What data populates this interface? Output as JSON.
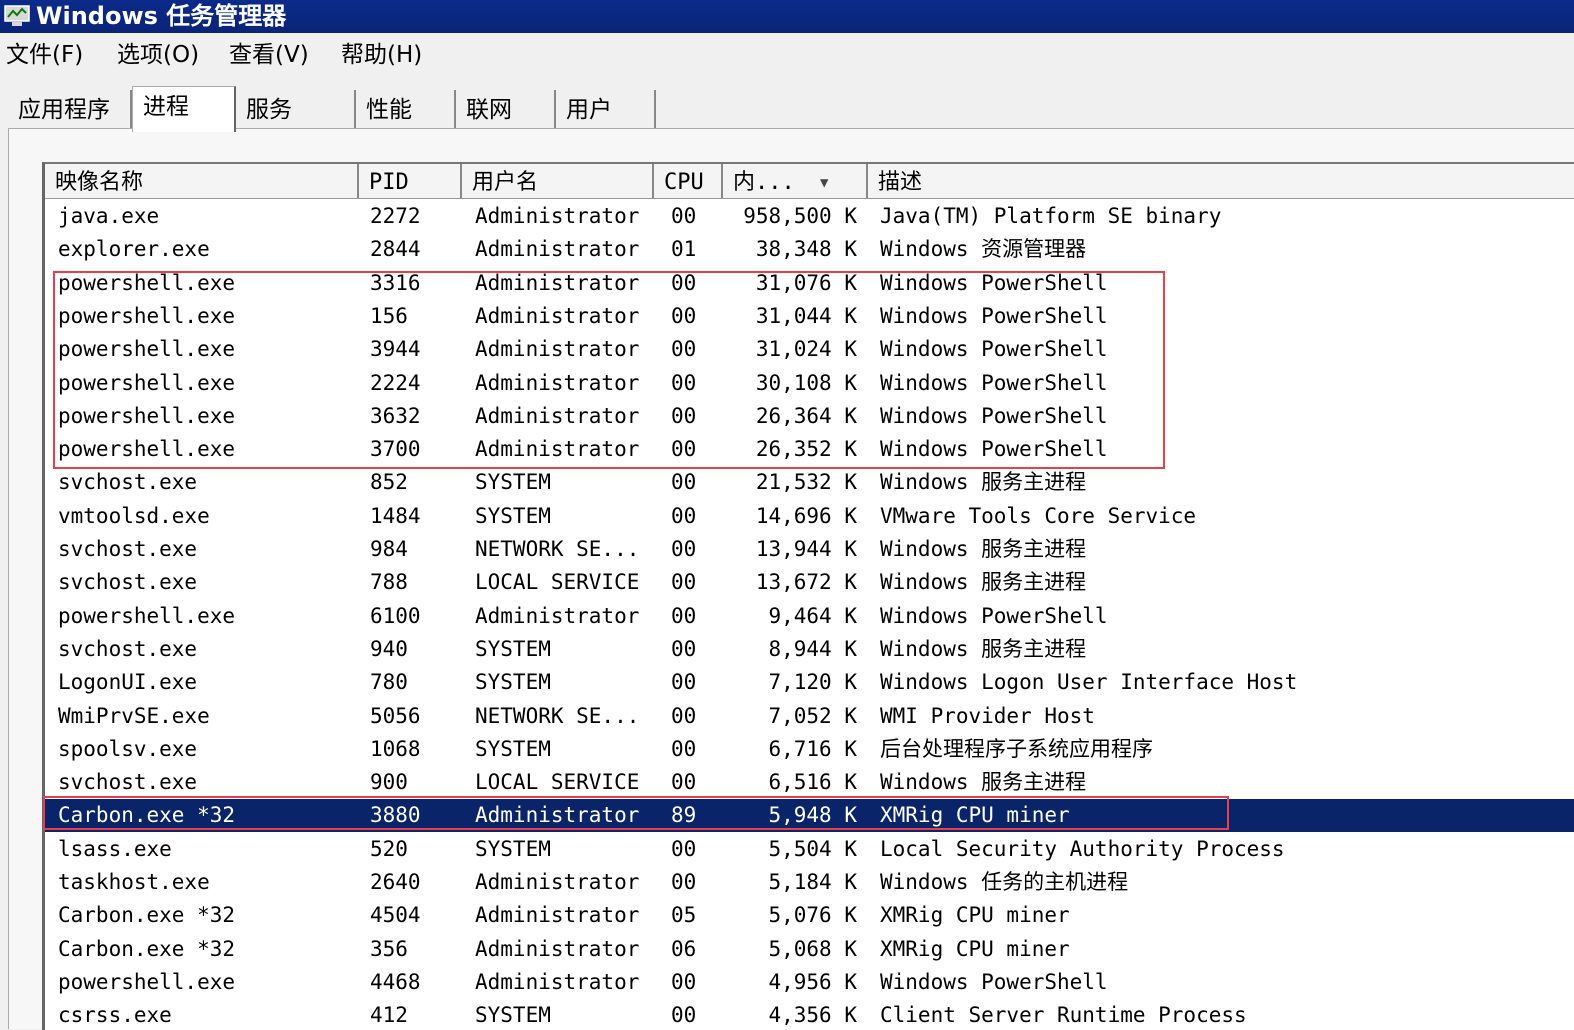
{
  "window": {
    "title": "Windows 任务管理器",
    "icon": "task-manager-icon"
  },
  "menu": [
    "文件(F)",
    "选项(O)",
    "查看(V)",
    "帮助(H)"
  ],
  "tabs": [
    {
      "label": "应用程序",
      "active": false
    },
    {
      "label": "进程",
      "active": true
    },
    {
      "label": "服务",
      "active": false
    },
    {
      "label": "性能",
      "active": false
    },
    {
      "label": "联网",
      "active": false
    },
    {
      "label": "用户",
      "active": false
    }
  ],
  "table": {
    "columns": [
      "映像名称",
      "PID",
      "用户名",
      "CPU",
      "内...",
      "描述"
    ],
    "sort_column": "内...",
    "sort_direction": "descending",
    "rows": [
      {
        "name": "java.exe",
        "pid": "2272",
        "user": "Administrator",
        "cpu": "00",
        "mem": "958,500 K",
        "desc": "Java(TM) Platform SE binary"
      },
      {
        "name": "explorer.exe",
        "pid": "2844",
        "user": "Administrator",
        "cpu": "01",
        "mem": "38,348 K",
        "desc": "Windows 资源管理器"
      },
      {
        "name": "powershell.exe",
        "pid": "3316",
        "user": "Administrator",
        "cpu": "00",
        "mem": "31,076 K",
        "desc": "Windows PowerShell"
      },
      {
        "name": "powershell.exe",
        "pid": "156",
        "user": "Administrator",
        "cpu": "00",
        "mem": "31,044 K",
        "desc": "Windows PowerShell"
      },
      {
        "name": "powershell.exe",
        "pid": "3944",
        "user": "Administrator",
        "cpu": "00",
        "mem": "31,024 K",
        "desc": "Windows PowerShell"
      },
      {
        "name": "powershell.exe",
        "pid": "2224",
        "user": "Administrator",
        "cpu": "00",
        "mem": "30,108 K",
        "desc": "Windows PowerShell"
      },
      {
        "name": "powershell.exe",
        "pid": "3632",
        "user": "Administrator",
        "cpu": "00",
        "mem": "26,364 K",
        "desc": "Windows PowerShell"
      },
      {
        "name": "powershell.exe",
        "pid": "3700",
        "user": "Administrator",
        "cpu": "00",
        "mem": "26,352 K",
        "desc": "Windows PowerShell"
      },
      {
        "name": "svchost.exe",
        "pid": "852",
        "user": "SYSTEM",
        "cpu": "00",
        "mem": "21,532 K",
        "desc": "Windows 服务主进程"
      },
      {
        "name": "vmtoolsd.exe",
        "pid": "1484",
        "user": "SYSTEM",
        "cpu": "00",
        "mem": "14,696 K",
        "desc": "VMware Tools Core Service"
      },
      {
        "name": "svchost.exe",
        "pid": "984",
        "user": "NETWORK SE...",
        "cpu": "00",
        "mem": "13,944 K",
        "desc": "Windows 服务主进程"
      },
      {
        "name": "svchost.exe",
        "pid": "788",
        "user": "LOCAL SERVICE",
        "cpu": "00",
        "mem": "13,672 K",
        "desc": "Windows 服务主进程"
      },
      {
        "name": "powershell.exe",
        "pid": "6100",
        "user": "Administrator",
        "cpu": "00",
        "mem": "9,464 K",
        "desc": "Windows PowerShell"
      },
      {
        "name": "svchost.exe",
        "pid": "940",
        "user": "SYSTEM",
        "cpu": "00",
        "mem": "8,944 K",
        "desc": "Windows 服务主进程"
      },
      {
        "name": "LogonUI.exe",
        "pid": "780",
        "user": "SYSTEM",
        "cpu": "00",
        "mem": "7,120 K",
        "desc": "Windows Logon User Interface Host"
      },
      {
        "name": "WmiPrvSE.exe",
        "pid": "5056",
        "user": "NETWORK SE...",
        "cpu": "00",
        "mem": "7,052 K",
        "desc": "WMI Provider Host"
      },
      {
        "name": "spoolsv.exe",
        "pid": "1068",
        "user": "SYSTEM",
        "cpu": "00",
        "mem": "6,716 K",
        "desc": "后台处理程序子系统应用程序"
      },
      {
        "name": "svchost.exe",
        "pid": "900",
        "user": "LOCAL SERVICE",
        "cpu": "00",
        "mem": "6,516 K",
        "desc": "Windows 服务主进程"
      },
      {
        "name": "Carbon.exe *32",
        "pid": "3880",
        "user": "Administrator",
        "cpu": "89",
        "mem": "5,948 K",
        "desc": "XMRig CPU miner",
        "selected": true
      },
      {
        "name": "lsass.exe",
        "pid": "520",
        "user": "SYSTEM",
        "cpu": "00",
        "mem": "5,504 K",
        "desc": "Local Security Authority Process"
      },
      {
        "name": "taskhost.exe",
        "pid": "2640",
        "user": "Administrator",
        "cpu": "00",
        "mem": "5,184 K",
        "desc": "Windows 任务的主机进程"
      },
      {
        "name": "Carbon.exe *32",
        "pid": "4504",
        "user": "Administrator",
        "cpu": "05",
        "mem": "5,076 K",
        "desc": "XMRig CPU miner"
      },
      {
        "name": "Carbon.exe *32",
        "pid": "356",
        "user": "Administrator",
        "cpu": "06",
        "mem": "5,068 K",
        "desc": "XMRig CPU miner"
      },
      {
        "name": "powershell.exe",
        "pid": "4468",
        "user": "Administrator",
        "cpu": "00",
        "mem": "4,956 K",
        "desc": "Windows PowerShell"
      },
      {
        "name": "csrss.exe",
        "pid": "412",
        "user": "SYSTEM",
        "cpu": "00",
        "mem": "4,356 K",
        "desc": "Client Server Runtime Process"
      }
    ]
  },
  "annotations": {
    "color": "#e8404a"
  },
  "colors": {
    "titlebar": "#0a2477",
    "selection": "#0a246a"
  }
}
